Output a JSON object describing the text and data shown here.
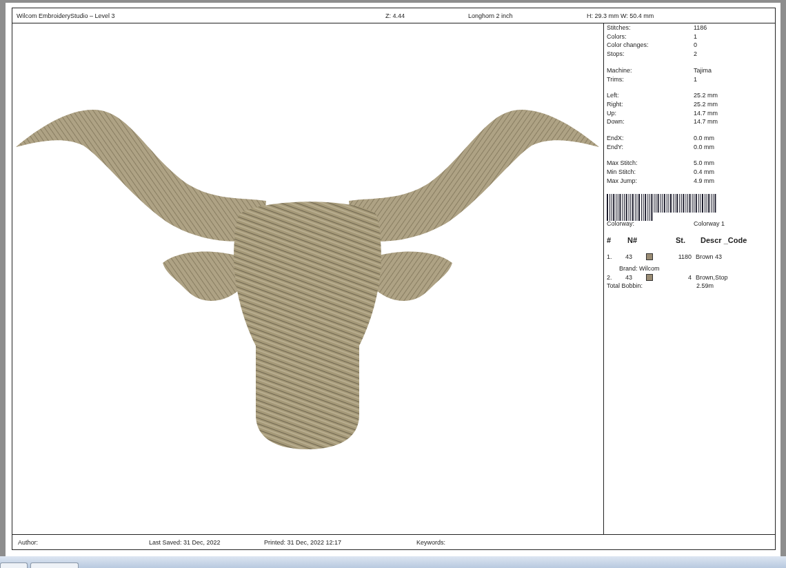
{
  "header": {
    "app_title": "Wilcom EmbroideryStudio – Level 3",
    "zoom": "Z: 4.44",
    "design_name": "Longhorn 2 inch",
    "size": "H: 29.3 mm  W: 50.4 mm"
  },
  "stats": [
    [
      {
        "label": "Stitches:",
        "value": "1186"
      },
      {
        "label": "Colors:",
        "value": "1"
      },
      {
        "label": "Color changes:",
        "value": "0"
      },
      {
        "label": "Stops:",
        "value": "2"
      }
    ],
    [
      {
        "label": "Machine:",
        "value": "Tajima"
      },
      {
        "label": "Trims:",
        "value": "1"
      }
    ],
    [
      {
        "label": "Left:",
        "value": "25.2 mm"
      },
      {
        "label": "Right:",
        "value": "25.2 mm"
      },
      {
        "label": "Up:",
        "value": "14.7 mm"
      },
      {
        "label": "Down:",
        "value": "14.7 mm"
      }
    ],
    [
      {
        "label": "EndX:",
        "value": "0.0 mm"
      },
      {
        "label": "EndY:",
        "value": "0.0 mm"
      }
    ],
    [
      {
        "label": "Max Stitch:",
        "value": "5.0 mm"
      },
      {
        "label": "Min Stitch:",
        "value": "0.4 mm"
      },
      {
        "label": "Max Jump:",
        "value": "4.9 mm"
      }
    ]
  ],
  "colorway": {
    "label": "Colorway:",
    "value": "Colorway 1"
  },
  "color_table": {
    "columns": [
      "#",
      "N#",
      "St.",
      "Descr _Code"
    ],
    "rows": [
      {
        "index": "1.",
        "code": "43",
        "color": "#9a8c74",
        "stitches": "1180",
        "description": "Brown 43",
        "brand": "Brand: Wilcom"
      },
      {
        "index": "2.",
        "code": "43",
        "color": "#9a8c74",
        "stitches": "4",
        "description": "Brown,Stop"
      }
    ]
  },
  "total_bobbin": {
    "label": "Total Bobbin:",
    "value": "2.59m"
  },
  "footer": {
    "author": "Author:",
    "last_saved": "Last Saved: 31 Dec, 2022",
    "printed": "Printed: 31 Dec, 2022 12:17",
    "keywords": "Keywords:"
  }
}
